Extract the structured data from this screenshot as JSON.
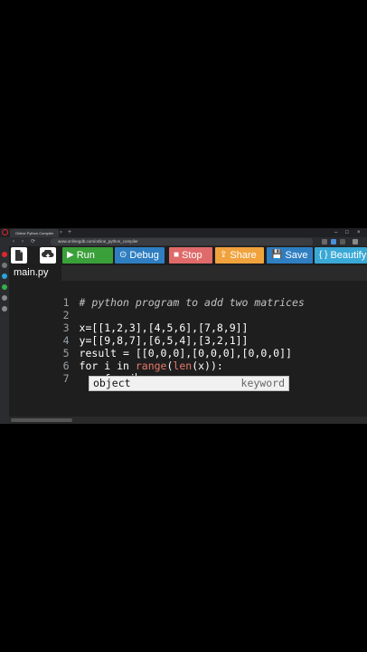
{
  "browser": {
    "tab_title": "Online Python Compiler",
    "tab_close": "×",
    "new_tab": "+",
    "url": "www.onlinegdb.com/online_python_compiler",
    "window_controls": [
      "–",
      "□",
      "×"
    ],
    "nav_glyphs": [
      "‹",
      "›",
      "⟳"
    ]
  },
  "toolbar": {
    "buttons": [
      {
        "label": "Run",
        "glyph": "▶",
        "color": "#3aa03a"
      },
      {
        "label": "Debug",
        "glyph": "⊙",
        "color": "#2f7ec2"
      },
      {
        "label": "Stop",
        "glyph": "■",
        "color": "#e06a6a"
      },
      {
        "label": "Share",
        "glyph": "⇪",
        "color": "#f0a23c"
      },
      {
        "label": "Save",
        "glyph": "💾",
        "color": "#2f7ec2"
      },
      {
        "label": "Beautify",
        "glyph": "{ }",
        "color": "#3aa9d6"
      }
    ]
  },
  "file_tab": "main.py",
  "code": {
    "lines": [
      {
        "n": "1",
        "text": "# python program to add two matrices"
      },
      {
        "n": "2",
        "text": ""
      },
      {
        "n": "3",
        "text": "x=[[1,2,3],[4,5,6],[7,8,9]]"
      },
      {
        "n": "4",
        "text": "y=[[9,8,7],[6,5,4],[3,2,1]]"
      },
      {
        "n": "5",
        "text": "result = [[0,0,0],[0,0,0],[0,0,0]]"
      },
      {
        "n": "6",
        "pre": "for i in ",
        "fn1": "range",
        "paren1": "(",
        "fn2": "len",
        "post": "(x)):"
      },
      {
        "n": "7",
        "text": "    for j"
      }
    ]
  },
  "autocomplete": {
    "word": "object",
    "kind": "keyword"
  }
}
